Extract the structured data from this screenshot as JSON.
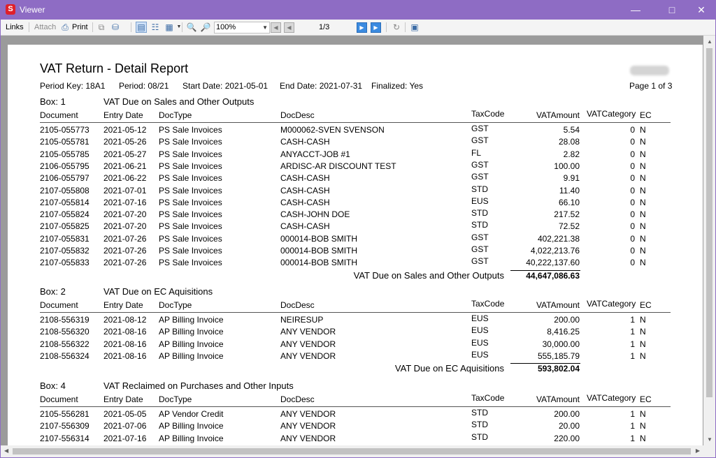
{
  "window": {
    "title": "Viewer",
    "app_icon": "S"
  },
  "toolbar": {
    "links_label": "Links",
    "attach_label": "Attach",
    "print_label": "Print",
    "zoom_value": "100%",
    "page_indicator": "1/3"
  },
  "report": {
    "title": "VAT Return - Detail Report",
    "period_key": "Period Key: 18A1",
    "period": "Period: 08/21",
    "start_date": "Start Date: 2021-05-01",
    "end_date": "End Date: 2021-07-31",
    "finalized": "Finalized: Yes",
    "page_of": "Page 1 of 3",
    "columns": {
      "document": "Document",
      "entry_date": "Entry Date",
      "doc_type": "DocType",
      "doc_desc": "DocDesc",
      "tax_code": "TaxCode",
      "vat_amount": "VATAmount",
      "vat_category": "VATCategory",
      "ec": "EC"
    },
    "sections": [
      {
        "box": "Box: 1",
        "heading": "VAT Due on Sales and Other Outputs",
        "total_label": "VAT Due on Sales and Other Outputs",
        "total_value": "44,647,086.63",
        "rows": [
          [
            "2105-055773",
            "2021-05-12",
            "PS Sale Invoices",
            "M000062-SVEN SVENSON",
            "GST",
            "5.54",
            "0",
            "N"
          ],
          [
            "2105-055781",
            "2021-05-26",
            "PS Sale Invoices",
            "CASH-CASH",
            "GST",
            "28.08",
            "0",
            "N"
          ],
          [
            "2105-055785",
            "2021-05-27",
            "PS Sale Invoices",
            "ANYACCT-JOB #1",
            "FL",
            "2.82",
            "0",
            "N"
          ],
          [
            "2106-055795",
            "2021-06-21",
            "PS Sale Invoices",
            "ARDISC-AR DISCOUNT TEST",
            "GST",
            "100.00",
            "0",
            "N"
          ],
          [
            "2106-055797",
            "2021-06-22",
            "PS Sale Invoices",
            "CASH-CASH",
            "GST",
            "9.91",
            "0",
            "N"
          ],
          [
            "2107-055808",
            "2021-07-01",
            "PS Sale Invoices",
            "CASH-CASH",
            "STD",
            "11.40",
            "0",
            "N"
          ],
          [
            "2107-055814",
            "2021-07-16",
            "PS Sale Invoices",
            "CASH-CASH",
            "EUS",
            "66.10",
            "0",
            "N"
          ],
          [
            "2107-055824",
            "2021-07-20",
            "PS Sale Invoices",
            "CASH-JOHN DOE",
            "STD",
            "217.52",
            "0",
            "N"
          ],
          [
            "2107-055825",
            "2021-07-20",
            "PS Sale Invoices",
            "CASH-CASH",
            "STD",
            "72.52",
            "0",
            "N"
          ],
          [
            "2107-055831",
            "2021-07-26",
            "PS Sale Invoices",
            "000014-BOB SMITH",
            "GST",
            "402,221.38",
            "0",
            "N"
          ],
          [
            "2107-055832",
            "2021-07-26",
            "PS Sale Invoices",
            "000014-BOB SMITH",
            "GST",
            "4,022,213.76",
            "0",
            "N"
          ],
          [
            "2107-055833",
            "2021-07-26",
            "PS Sale Invoices",
            "000014-BOB SMITH",
            "GST",
            "40,222,137.60",
            "0",
            "N"
          ]
        ]
      },
      {
        "box": "Box: 2",
        "heading": "VAT Due on EC Aquisitions",
        "total_label": "VAT Due on EC Aquisitions",
        "total_value": "593,802.04",
        "rows": [
          [
            "2108-556319",
            "2021-08-12",
            "AP Billing Invoice",
            "NEIRESUP",
            "EUS",
            "200.00",
            "1",
            "N"
          ],
          [
            "2108-556320",
            "2021-08-16",
            "AP Billing Invoice",
            "ANY VENDOR",
            "EUS",
            "8,416.25",
            "1",
            "N"
          ],
          [
            "2108-556322",
            "2021-08-16",
            "AP Billing Invoice",
            "ANY VENDOR",
            "EUS",
            "30,000.00",
            "1",
            "N"
          ],
          [
            "2108-556324",
            "2021-08-16",
            "AP Billing Invoice",
            "ANY VENDOR",
            "EUS",
            "555,185.79",
            "1",
            "N"
          ]
        ]
      },
      {
        "box": "Box: 4",
        "heading": "VAT Reclaimed on Purchases and Other Inputs",
        "rows": [
          [
            "2105-556281",
            "2021-05-05",
            "AP Vendor Credit",
            "ANY VENDOR",
            "STD",
            "200.00",
            "1",
            "N"
          ],
          [
            "2107-556309",
            "2021-07-06",
            "AP Billing Invoice",
            "ANY VENDOR",
            "STD",
            "20.00",
            "1",
            "N"
          ],
          [
            "2107-556314",
            "2021-07-16",
            "AP Billing Invoice",
            "ANY VENDOR",
            "STD",
            "220.00",
            "1",
            "N"
          ]
        ]
      }
    ]
  }
}
